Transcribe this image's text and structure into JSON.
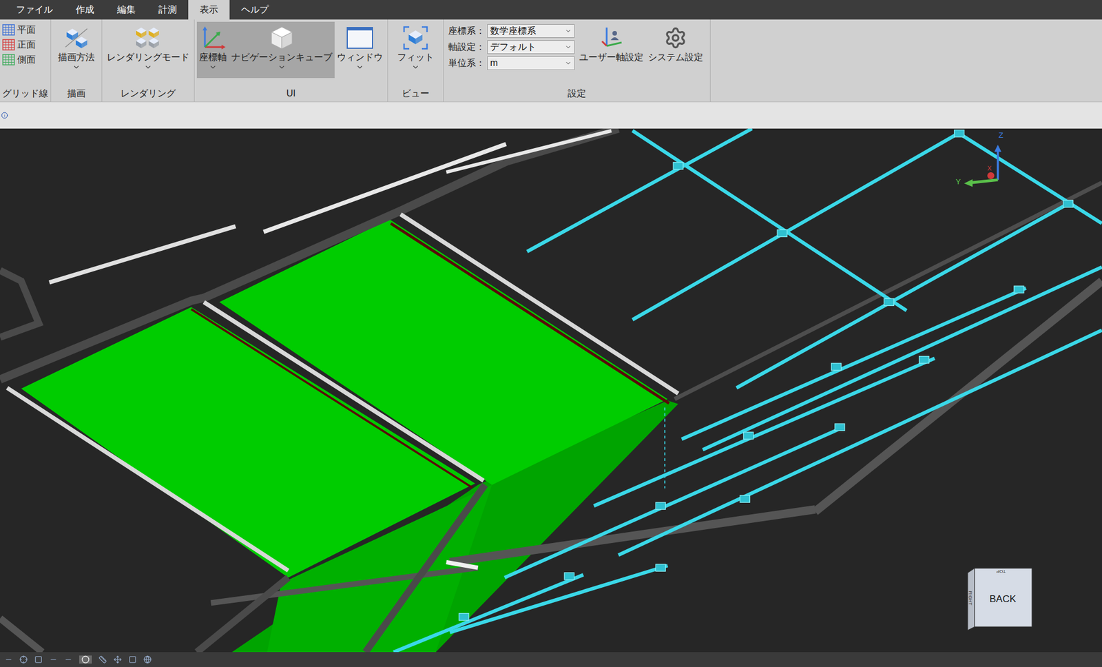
{
  "menu_tabs": [
    {
      "label": "ファイル",
      "selected": false
    },
    {
      "label": "作成",
      "selected": false
    },
    {
      "label": "編集",
      "selected": false
    },
    {
      "label": "計測",
      "selected": false
    },
    {
      "label": "表示",
      "selected": true
    },
    {
      "label": "ヘルプ",
      "selected": false
    }
  ],
  "grid_group": {
    "label": "グリッド線",
    "items": [
      {
        "label": "平面",
        "color": "#3b6fd6"
      },
      {
        "label": "正面",
        "color": "#d63b3b"
      },
      {
        "label": "側面",
        "color": "#3bab5a"
      }
    ]
  },
  "draw_group": {
    "label": "描画",
    "button": "描画方法"
  },
  "render_group": {
    "label": "レンダリング",
    "button": "レンダリングモード"
  },
  "ui_group": {
    "label": "UI",
    "buttons": [
      {
        "label": "座標軸",
        "selected": true,
        "kind": "axes"
      },
      {
        "label": "ナビゲーションキューブ",
        "selected": true,
        "kind": "cube"
      },
      {
        "label": "ウィンドウ",
        "selected": false,
        "kind": "window"
      }
    ]
  },
  "view_group": {
    "label": "ビュー",
    "button": "フィット"
  },
  "settings_group": {
    "label": "設定",
    "fields": [
      {
        "label": "座標系：",
        "value": "数学座標系"
      },
      {
        "label": "軸設定：",
        "value": "デフォルト"
      },
      {
        "label": "単位系：",
        "value": "m"
      }
    ],
    "buttons": [
      "ユーザー軸設定",
      "システム設定"
    ]
  },
  "axis_triad": {
    "z": "Z",
    "y": "Y",
    "x": "X"
  },
  "nav_cube": {
    "front": "BACK",
    "top": "TOP",
    "side": "RIGHT"
  }
}
